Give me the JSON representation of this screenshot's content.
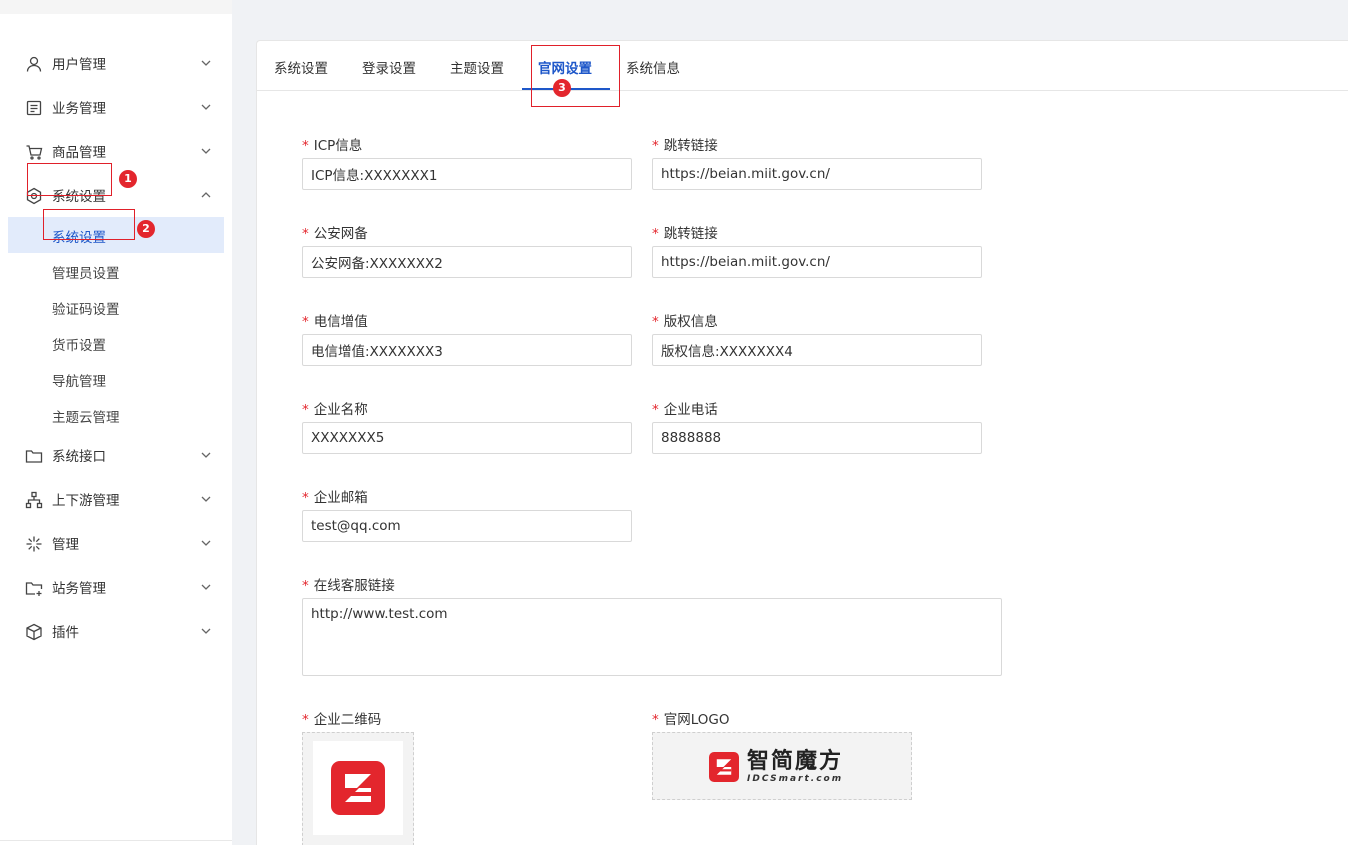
{
  "sidebar": {
    "menu": [
      {
        "label": "用户管理",
        "icon": "user-icon"
      },
      {
        "label": "业务管理",
        "icon": "document-icon"
      },
      {
        "label": "商品管理",
        "icon": "cart-icon"
      },
      {
        "label": "系统设置",
        "icon": "gear-icon"
      },
      {
        "label": "系统接口",
        "icon": "folder-icon"
      },
      {
        "label": "上下游管理",
        "icon": "network-icon"
      },
      {
        "label": "管理",
        "icon": "sparkle-icon"
      },
      {
        "label": "站务管理",
        "icon": "folder-plus-icon"
      },
      {
        "label": "插件",
        "icon": "cube-icon"
      }
    ],
    "submenu": [
      "系统设置",
      "管理员设置",
      "验证码设置",
      "货币设置",
      "导航管理",
      "主题云管理"
    ],
    "active_sub": "系统设置"
  },
  "annotations": [
    "1",
    "2",
    "3"
  ],
  "tabs": [
    {
      "label": "系统设置"
    },
    {
      "label": "登录设置"
    },
    {
      "label": "主题设置"
    },
    {
      "label": "官网设置",
      "active": true
    },
    {
      "label": "系统信息"
    }
  ],
  "form": {
    "required_mark": "*",
    "icp": {
      "label": "ICP信息",
      "value": "ICP信息:XXXXXXX1"
    },
    "icp_link": {
      "label": "跳转链接",
      "value": "https://beian.miit.gov.cn/"
    },
    "police": {
      "label": "公安网备",
      "value": "公安网备:XXXXXXX2"
    },
    "police_link": {
      "label": "跳转链接",
      "value": "https://beian.miit.gov.cn/"
    },
    "telecom": {
      "label": "电信增值",
      "value": "电信增值:XXXXXXX3"
    },
    "copyright": {
      "label": "版权信息",
      "value": "版权信息:XXXXXXX4"
    },
    "company_name": {
      "label": "企业名称",
      "value": "XXXXXXX5"
    },
    "company_phone": {
      "label": "企业电话",
      "value": "8888888"
    },
    "company_email": {
      "label": "企业邮箱",
      "value": "test@qq.com"
    },
    "online_service": {
      "label": "在线客服链接",
      "value": "http://www.test.com"
    },
    "qr_code": {
      "label": "企业二维码"
    },
    "site_logo": {
      "label": "官网LOGO",
      "logo_cn": "智简魔方",
      "logo_en": "IDCSmart.com"
    }
  },
  "colors": {
    "accent": "#1e57c9",
    "brand_red": "#e3262d",
    "active_bg": "#e2ebfb"
  }
}
